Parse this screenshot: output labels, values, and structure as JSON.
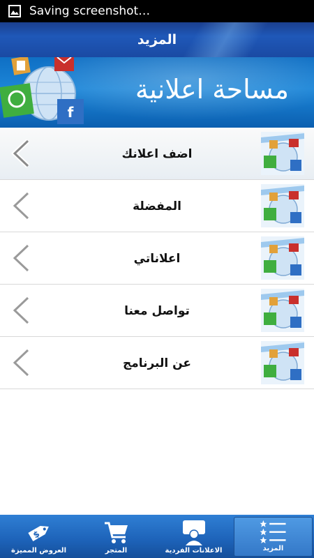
{
  "status_bar": {
    "text": "Saving screenshot…"
  },
  "header": {
    "title": "المزيد"
  },
  "banner": {
    "title": "مساحة اعلانية"
  },
  "menu": {
    "items": [
      {
        "label": "اضف اعلانك"
      },
      {
        "label": "المفضلة"
      },
      {
        "label": "اعلاناتي"
      },
      {
        "label": "تواصل معنا"
      },
      {
        "label": "عن البرنامج"
      }
    ]
  },
  "tabbar": {
    "tabs": [
      {
        "label": "العروض المميزة",
        "icon": "price-tag-icon",
        "active": false
      },
      {
        "label": "المتجر",
        "icon": "shopping-cart-icon",
        "active": false
      },
      {
        "label": "الاعلانات الفردية",
        "icon": "person-speech-icon",
        "active": false
      },
      {
        "label": "المزيد",
        "icon": "star-list-icon",
        "active": true
      }
    ]
  },
  "colors": {
    "header_blue": "#1f58b8",
    "banner_blue": "#1c86d8",
    "tab_blue": "#1d62b8"
  }
}
